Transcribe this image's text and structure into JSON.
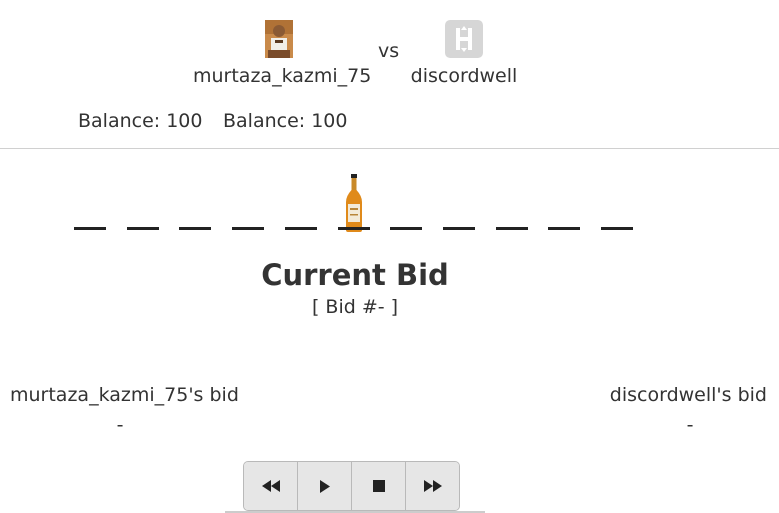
{
  "players": [
    {
      "name": "murtaza_kazmi_75",
      "balance": "Balance: 100",
      "bid_label": "murtaza_kazmi_75's bid",
      "bid_value": "-"
    },
    {
      "name": "discordwell",
      "balance": "Balance: 100",
      "bid_label": "discordwell's bid",
      "bid_value": "-"
    }
  ],
  "versus": "vs",
  "track": {
    "slot_count": 11,
    "bottle_slot": 5,
    "item_icon": "bottle-icon"
  },
  "current_bid": {
    "title": "Current Bid",
    "number": "[ Bid #- ]"
  },
  "controls": [
    {
      "name": "rewind-button",
      "icon": "rewind-icon"
    },
    {
      "name": "play-button",
      "icon": "play-icon"
    },
    {
      "name": "stop-button",
      "icon": "stop-icon"
    },
    {
      "name": "fast-forward-button",
      "icon": "fast-forward-icon"
    }
  ],
  "colors": {
    "bottle_liquid": "#e08a1a",
    "text": "#333333",
    "control_bg": "#e6e6e6"
  }
}
